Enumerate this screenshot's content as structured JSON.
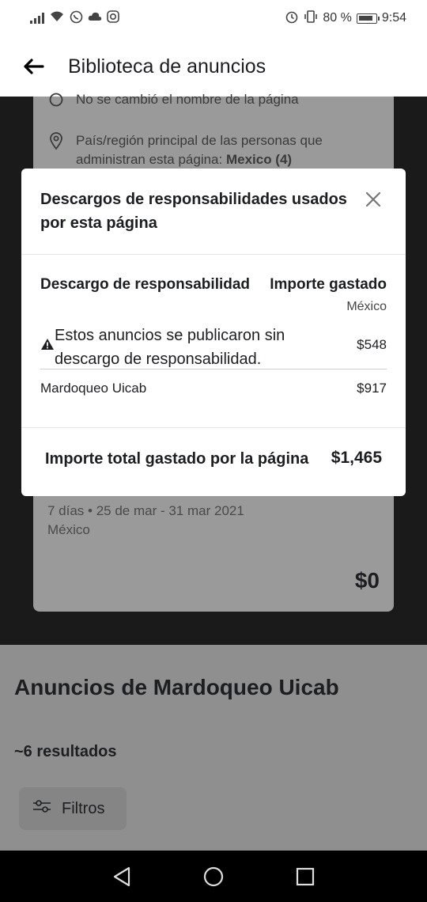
{
  "status_bar": {
    "battery_percent": "80 %",
    "time": "9:54",
    "icons": [
      "signal-icon",
      "wifi-icon",
      "whatsapp-icon",
      "cloud-icon",
      "instagram-icon",
      "alarm-icon",
      "vibrate-icon",
      "battery-icon"
    ]
  },
  "app_bar": {
    "title": "Biblioteca de anuncios"
  },
  "background_card": {
    "name_change_text": "No se cambió el nombre de la página",
    "country_label": "País/región principal de las personas que administran esta página: ",
    "country_value": "Mexico (4)",
    "period": "7 días • 25 de mar - 31 mar 2021",
    "region": "México",
    "amount": "$0"
  },
  "page_section": {
    "title": "Anuncios de Mardoqueo Uicab",
    "results": "~6 resultados",
    "filter_label": "Filtros"
  },
  "modal": {
    "title": "Descargos de responsabilidades usados por esta página",
    "col_disclaimer": "Descargo de responsabilidad",
    "col_amount": "Importe gastado",
    "col_amount_sub": "México",
    "rows": [
      {
        "label": "Estos anuncios se publicaron sin descargo de responsabilidad.",
        "amount": "$548"
      },
      {
        "label": "Mardoqueo Uicab",
        "amount": "$917"
      }
    ],
    "total_label": "Importe total gastado por la página",
    "total_amount": "$1,465"
  }
}
